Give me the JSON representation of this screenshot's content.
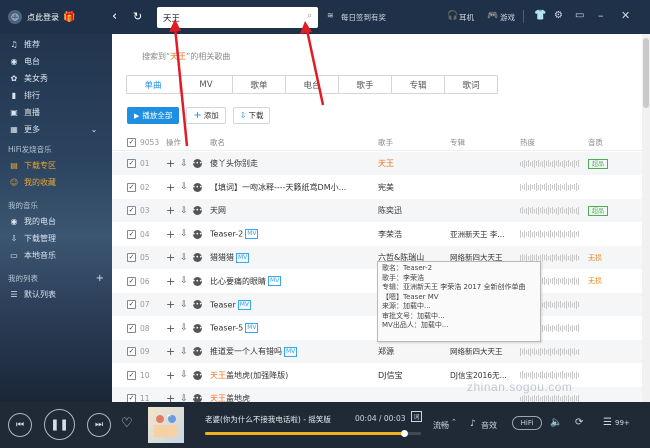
{
  "header": {
    "login_text": "点此登录",
    "search_value": "天王",
    "sign_in_text": "每日签到有奖",
    "earphone_label": "耳机",
    "game_label": "游戏"
  },
  "sidebar": {
    "top_items": [
      {
        "label": "推荐",
        "icon": "music-note-icon"
      },
      {
        "label": "电台",
        "icon": "radio-icon"
      },
      {
        "label": "美女秀",
        "icon": "flower-icon"
      },
      {
        "label": "排行",
        "icon": "bars-icon"
      },
      {
        "label": "直播",
        "icon": "live-icon"
      },
      {
        "label": "更多",
        "icon": "grid-icon"
      }
    ],
    "hifi_section": "HiFi发烧音乐",
    "hifi_items": [
      {
        "label": "下载专区",
        "icon": "folder-icon"
      },
      {
        "label": "我的收藏",
        "icon": "smile-icon"
      }
    ],
    "my_music_section": "我的音乐",
    "my_music_items": [
      {
        "label": "我的电台",
        "icon": "radio-icon"
      },
      {
        "label": "下载管理",
        "icon": "download-icon"
      },
      {
        "label": "本地音乐",
        "icon": "monitor-icon"
      }
    ],
    "my_list_section": "我的列表",
    "my_list_items": [
      {
        "label": "默认列表",
        "icon": "list-icon"
      }
    ]
  },
  "main": {
    "search_info_prefix": "搜索到“",
    "search_info_keyword": "天王",
    "search_info_suffix": "”的相关歌曲",
    "tabs": [
      "单曲",
      "MV",
      "歌单",
      "电台",
      "歌手",
      "专辑",
      "歌词"
    ],
    "actions": {
      "play_all": "播放全部",
      "add": "添加",
      "download": "下载"
    },
    "columns": {
      "count": "9053",
      "ops": "操作",
      "song": "歌名",
      "artist": "歌手",
      "album": "专辑",
      "hot": "热度",
      "quality": "音质"
    },
    "rows": [
      {
        "num": "01",
        "song": "傻丫头你别走",
        "mv": "",
        "artist": "天王",
        "artist_hl": true,
        "album": "",
        "quality": "超品",
        "checked": true
      },
      {
        "num": "02",
        "song": "【填词】一吻冰释----天籁纸鸢DM小...",
        "mv": "",
        "artist": "宪美",
        "artist_hl": false,
        "album": "",
        "quality": "",
        "checked": true
      },
      {
        "num": "03",
        "song": "天网",
        "mv": "",
        "artist": "陈奕迅",
        "artist_hl": false,
        "album": "",
        "quality": "超品",
        "checked": true
      },
      {
        "num": "04",
        "song": "Teaser-2",
        "mv": "MV",
        "artist": "李荣浩",
        "artist_hl": false,
        "album": "亚洲新天王 李...",
        "quality": "",
        "checked": true
      },
      {
        "num": "05",
        "song": "猎猎猎",
        "mv": "MV",
        "artist": "六哲&陈瑞山",
        "artist_hl": false,
        "album": "网络新四大天王",
        "quality": "无损",
        "checked": true
      },
      {
        "num": "06",
        "song": "比心要痛的眼睛",
        "mv": "MV",
        "artist": "",
        "artist_hl": false,
        "album": "",
        "quality": "无损",
        "checked": true
      },
      {
        "num": "07",
        "song": "Teaser",
        "mv": "MV",
        "artist": "",
        "artist_hl": false,
        "album": "",
        "quality": "",
        "checked": true
      },
      {
        "num": "08",
        "song": "Teaser-5",
        "mv": "MV",
        "artist": "",
        "artist_hl": false,
        "album": "",
        "quality": "",
        "checked": true
      },
      {
        "num": "09",
        "song": "推道爱一个人有错吗",
        "mv": "MV",
        "artist": "郑源",
        "artist_hl": false,
        "album": "网络新四大天王",
        "quality": "",
        "checked": true
      },
      {
        "num": "10",
        "song": "天王盖地虎(加强降版)",
        "mv": "",
        "artist": "DJ信宝",
        "artist_hl": false,
        "album": "DJ信宝2016无...",
        "quality": "",
        "checked": true
      },
      {
        "num": "11",
        "song": "天王盖地虎",
        "mv": "",
        "artist": "",
        "artist_hl": false,
        "album": "",
        "quality": "",
        "checked": true
      }
    ],
    "tooltip": [
      "歌名：Teaser-2",
      "歌手：李荣浩",
      "专辑：亚洲新天王 李荣浩 2017 全新创作单曲",
      "【嗯】Teaser MV",
      "来源：加载中...",
      "审批文号：加载中...",
      "MV出品人：加载中..."
    ],
    "watermark": "zhinan.sogou.com"
  },
  "player": {
    "song_title": "老婆(你为什么不接我电话啦) - 摇笑版",
    "time": "00:04 / 00:03",
    "mode_label": "流畅",
    "effect_label": "音效",
    "hifi_label": "HiFi",
    "badge": "99+",
    "progress": 0.92
  }
}
